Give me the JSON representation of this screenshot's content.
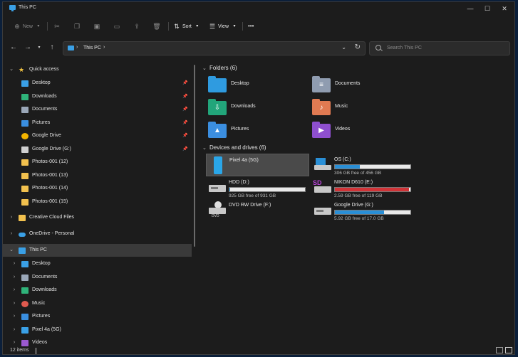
{
  "window": {
    "title": "This PC",
    "minimize": "—",
    "maximize": "☐",
    "close": "✕"
  },
  "toolbar": {
    "new_label": "New",
    "sort_label": "Sort",
    "view_label": "View",
    "more_label": "•••"
  },
  "address": {
    "crumb": "This PC",
    "search_placeholder": "Search This PC"
  },
  "nav": {
    "quick_access": "Quick access",
    "quick_items": [
      {
        "label": "Desktop",
        "icon": "desktop-icon",
        "color": "#3aa0e6"
      },
      {
        "label": "Downloads",
        "icon": "download-icon",
        "color": "#2fb37a"
      },
      {
        "label": "Documents",
        "icon": "document-icon",
        "color": "#9aa7b8"
      },
      {
        "label": "Pictures",
        "icon": "pictures-icon",
        "color": "#3a8fe0"
      },
      {
        "label": "Google Drive",
        "icon": "google-drive-icon",
        "color": "#f4b400"
      },
      {
        "label": "Google Drive (G:)",
        "icon": "drive-icon",
        "color": "#cfcfcf"
      },
      {
        "label": "Photos-001 (12)",
        "icon": "folder-icon",
        "color": "#f2c14e"
      },
      {
        "label": "Photos-001 (13)",
        "icon": "folder-icon",
        "color": "#f2c14e"
      },
      {
        "label": "Photos-001 (14)",
        "icon": "folder-icon",
        "color": "#f2c14e"
      },
      {
        "label": "Photos-001 (15)",
        "icon": "folder-icon",
        "color": "#f2c14e"
      }
    ],
    "creative_cloud": "Creative Cloud Files",
    "onedrive": "OneDrive - Personal",
    "this_pc": "This PC",
    "pc_items": [
      {
        "label": "Desktop",
        "icon": "desktop-icon",
        "color": "#3aa0e6"
      },
      {
        "label": "Documents",
        "icon": "document-icon",
        "color": "#9aa7b8"
      },
      {
        "label": "Downloads",
        "icon": "download-icon",
        "color": "#2fb37a"
      },
      {
        "label": "Music",
        "icon": "music-icon",
        "color": "#e05a4f"
      },
      {
        "label": "Pictures",
        "icon": "pictures-icon",
        "color": "#3a8fe0"
      },
      {
        "label": "Pixel 4a (5G)",
        "icon": "phone-icon",
        "color": "#3aa0e6"
      },
      {
        "label": "Videos",
        "icon": "videos-icon",
        "color": "#9b59d0"
      }
    ]
  },
  "content": {
    "folders_header": "Folders (6)",
    "folders": [
      {
        "label": "Desktop",
        "icon": "desktop-folder-icon",
        "color": "#2f9be0",
        "glyph": ""
      },
      {
        "label": "Documents",
        "icon": "documents-folder-icon",
        "color": "#8f9cb0",
        "glyph": "≡"
      },
      {
        "label": "Downloads",
        "icon": "downloads-folder-icon",
        "color": "#22a57a",
        "glyph": "⇩"
      },
      {
        "label": "Music",
        "icon": "music-folder-icon",
        "color": "#e07a52",
        "glyph": "♪"
      },
      {
        "label": "Pictures",
        "icon": "pictures-folder-icon",
        "color": "#3b8ee0",
        "glyph": "▲"
      },
      {
        "label": "Videos",
        "icon": "videos-folder-icon",
        "color": "#8e4fcf",
        "glyph": "▶"
      }
    ],
    "drives_header": "Devices and drives (6)",
    "drives": [
      {
        "name": "Pixel 4a (5G)",
        "icon": "phone-icon",
        "selected": true
      },
      {
        "name": "OS (C:)",
        "icon": "windows-drive-icon",
        "free": "306 GB free of 456 GB",
        "used": 0.33
      },
      {
        "name": "HDD (D:)",
        "icon": "hdd-icon",
        "free": "925 GB free of 931 GB",
        "used": 0.01
      },
      {
        "name": "NIKON D610  (E:)",
        "icon": "sd-card-icon",
        "free": "2.59 GB free of 119 GB",
        "used": 0.98,
        "warn": true
      },
      {
        "name": "DVD RW Drive (F:)",
        "icon": "dvd-drive-icon"
      },
      {
        "name": "Google Drive (G:)",
        "icon": "hdd-icon",
        "free": "5.92 GB free of 17.0 GB",
        "used": 0.65
      }
    ]
  },
  "status": {
    "items": "12 items"
  }
}
